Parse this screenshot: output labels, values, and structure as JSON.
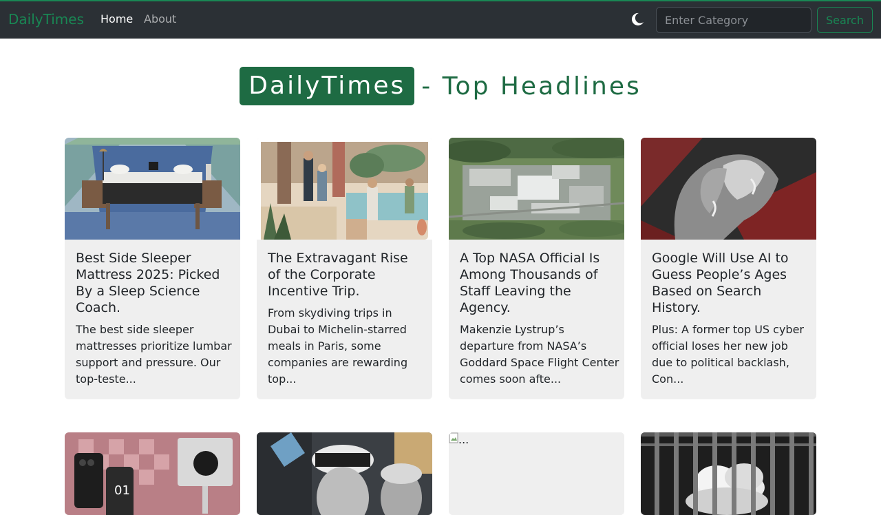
{
  "nav": {
    "brand": "DailyTimes",
    "links": [
      "Home",
      "About"
    ],
    "search_placeholder": "Enter Category",
    "search_label": "Search"
  },
  "headline": {
    "badge": "DailyTimes",
    "rest": "- Top Headlines"
  },
  "articles": [
    {
      "title": "Best Side Sleeper Mattress 2025: Picked By a Sleep Science Coach.",
      "description": "The best side sleeper mattresses prioritize lumbar support and pressure. Our top-teste..."
    },
    {
      "title": "The Extravagant Rise of the Corporate Incentive Trip.",
      "description": "From skydiving trips in Dubai to Michelin-starred meals in Paris, some companies are rewarding top..."
    },
    {
      "title": "A Top NASA Official Is Among Thousands of Staff Leaving the Agency.",
      "description": "Makenzie Lystrup’s departure from NASA’s Goddard Space Flight Center comes soon afte..."
    },
    {
      "title": "Google Will Use AI to Guess People’s Ages Based on Search History.",
      "description": "Plus: A former top US cyber official loses her new job due to political backlash, Con..."
    }
  ],
  "second_row": {
    "broken_image_text": "..."
  },
  "colors": {
    "accent": "#198754",
    "navbar": "#2b3035",
    "headline": "#1e6b43",
    "card": "#efefef"
  }
}
